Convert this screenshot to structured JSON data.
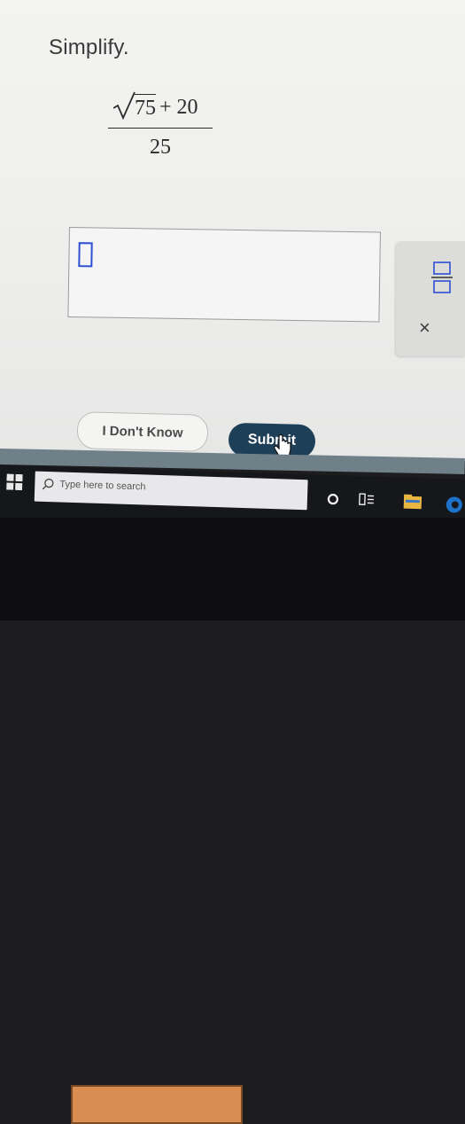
{
  "problem": {
    "instruction": "Simplify.",
    "radicand": "75",
    "plus_term": "+ 20",
    "denominator": "25"
  },
  "palette": {
    "fraction_icon": "fraction-template-icon",
    "close_label": "×"
  },
  "buttons": {
    "dont_know_label": "I Don't Know",
    "submit_label": "Submit"
  },
  "taskbar": {
    "search_placeholder": "Type here to search"
  },
  "colors": {
    "submit_bg": "#1e3f58",
    "cursor_blue": "#2d4fd3",
    "taskbar_bg": "#16171a"
  }
}
